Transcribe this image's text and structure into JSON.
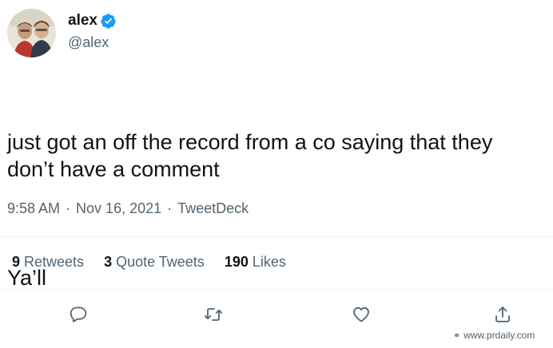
{
  "author": {
    "display_name": "alex",
    "handle": "@alex",
    "verified": true,
    "verified_color": "#1d9bf0"
  },
  "tweet": {
    "paragraphs": [
      "just got an off the record from a co saying that they don’t have a comment",
      "Ya’ll"
    ],
    "time": "9:58 AM",
    "date": "Nov 16, 2021",
    "source": "TweetDeck",
    "separator": "·"
  },
  "stats": [
    {
      "count": "9",
      "label": "Retweets"
    },
    {
      "count": "3",
      "label": "Quote Tweets"
    },
    {
      "count": "190",
      "label": "Likes"
    }
  ],
  "actions": [
    {
      "name": "reply",
      "icon": "reply-icon"
    },
    {
      "name": "retweet",
      "icon": "retweet-icon"
    },
    {
      "name": "like",
      "icon": "heart-icon"
    },
    {
      "name": "share",
      "icon": "share-icon"
    }
  ],
  "watermark": {
    "text": "www.prdaily.com"
  },
  "colors": {
    "text_primary": "#0f1419",
    "text_secondary": "#536471",
    "divider": "#eff3f4"
  }
}
